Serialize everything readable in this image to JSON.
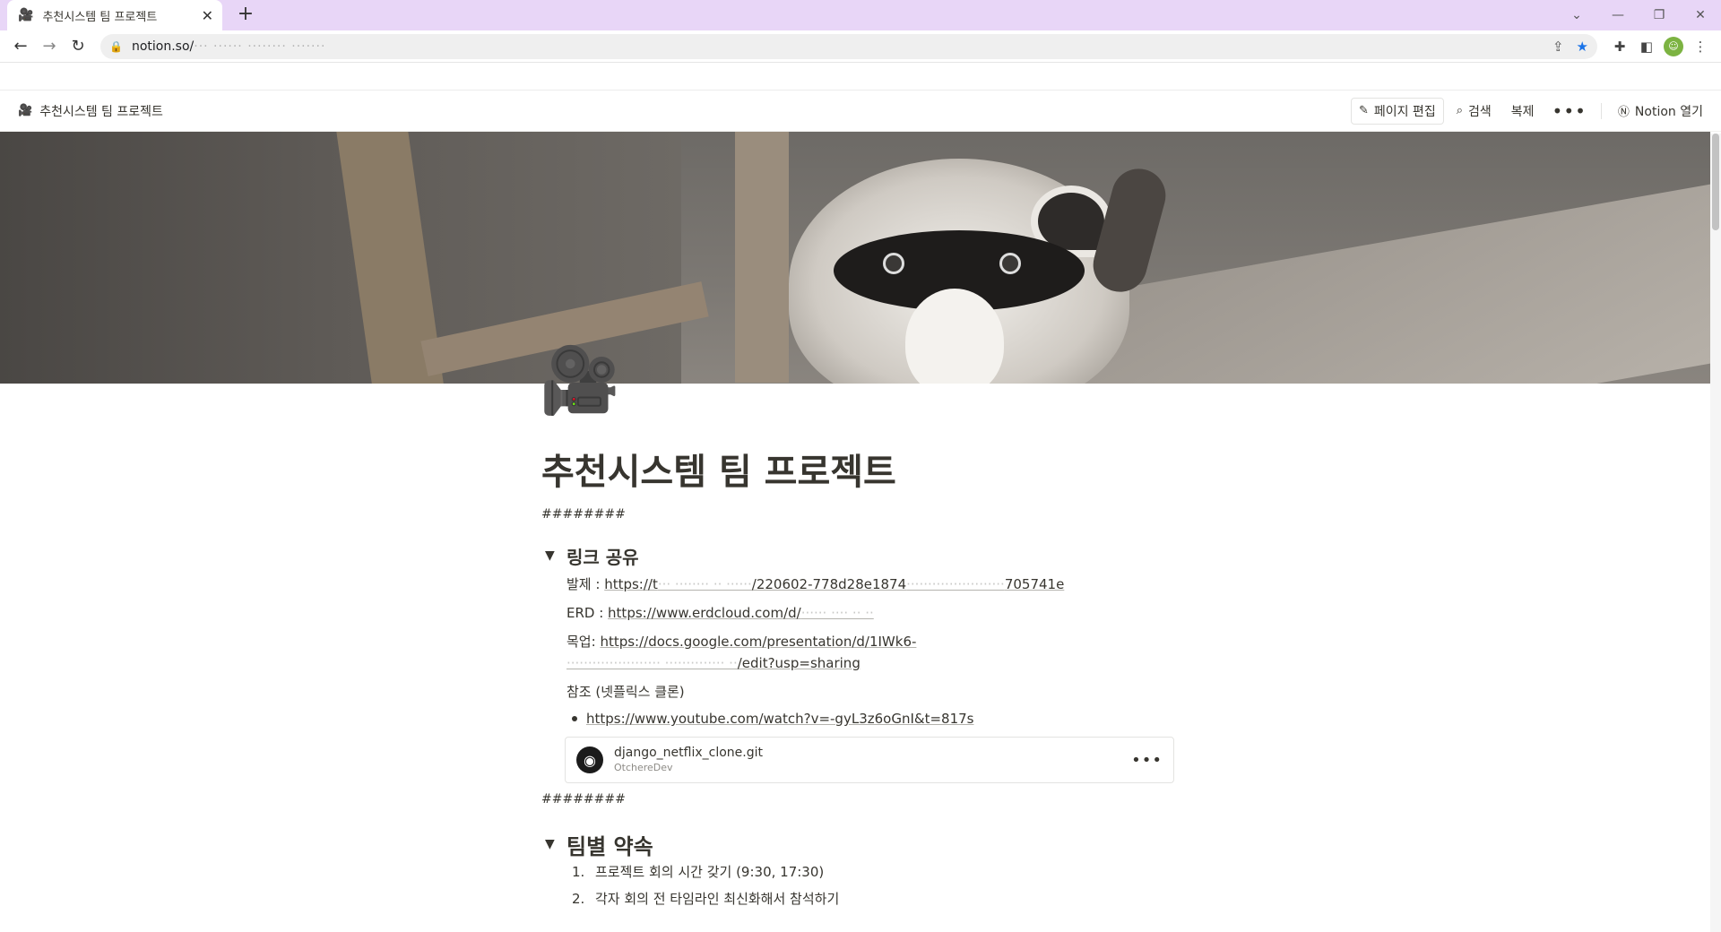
{
  "browser": {
    "tab_title": "추천시스템 팀 프로젝트",
    "tab_icon": "🎥",
    "url_visible": "notion.so/",
    "url_blurred": "··· ······ ········ ·······"
  },
  "topbar": {
    "breadcrumb": "추천시스템 팀 프로젝트",
    "edit_label": "페이지 편집",
    "search_label": "검색",
    "duplicate_label": "복제",
    "more_label": "•••",
    "open_notion_label": "Notion 열기"
  },
  "page": {
    "icon": "🎥",
    "title": "추천시스템 팀 프로젝트",
    "divider1": "########",
    "divider2": "########",
    "section1": {
      "heading": "링크 공유",
      "presentation_label": "발제 : ",
      "presentation_link_start": "https://t",
      "presentation_link_blur": "··· ········ ·· ······",
      "presentation_link_end": "/220602-778d28e1874",
      "presentation_link_blur2": "·······················",
      "presentation_link_tail": "705741e",
      "erd_label": "ERD : ",
      "erd_link": "https://www.erdcloud.com/d/",
      "erd_link_blur": "······ ···· ·· ··",
      "mockup_label": "목업: ",
      "mockup_link_1": "https://docs.google.com/presentation/d/1IWk6-",
      "mockup_link_2_blur": "······················ ·············· ··",
      "mockup_link_2_tail": "/edit?usp=sharing",
      "reference_label": "참조 (넷플릭스 클론)",
      "reference_link": "https://www.youtube.com/watch?v=-gyL3z6oGnI&t=817s",
      "bookmark_title": "django_netflix_clone.git",
      "bookmark_subtitle": "OtchereDev",
      "bookmark_more": "•••"
    },
    "section2": {
      "heading": "팀별 약속",
      "items": [
        {
          "num": "1.",
          "text": "프로젝트 회의 시간 갖기 (9:30, 17:30)"
        },
        {
          "num": "2.",
          "text": "각자 회의 전 타임라인 최신화해서 참석하기"
        }
      ]
    }
  }
}
